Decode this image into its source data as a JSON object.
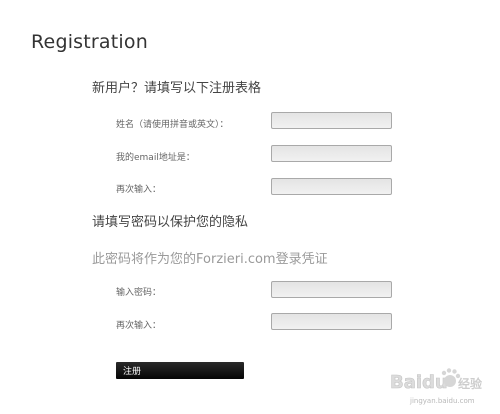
{
  "page": {
    "title": "Registration"
  },
  "new_user_section": {
    "heading": "新用户？请填写以下注册表格",
    "fields": [
      {
        "label": "姓名（请使用拼音或英文）：",
        "value": ""
      },
      {
        "label": "我的email地址是：",
        "value": ""
      },
      {
        "label": "再次输入：",
        "value": ""
      }
    ]
  },
  "password_section": {
    "heading": "请填写密码以保护您的隐私",
    "note": "此密码将作为您的Forzieri.com登录凭证",
    "fields": [
      {
        "label": "输入密码：",
        "value": ""
      },
      {
        "label": "再次输入：",
        "value": ""
      }
    ]
  },
  "submit": {
    "label": "注册"
  },
  "watermark": {
    "brand": "Baidu",
    "text_cn": "经验",
    "url": "jingyan.baidu.com"
  },
  "colors": {
    "button_bg": "#111111",
    "input_bg": "#ebebeb",
    "input_border": "#a9a9a9",
    "note_text": "#9a9a9a"
  }
}
